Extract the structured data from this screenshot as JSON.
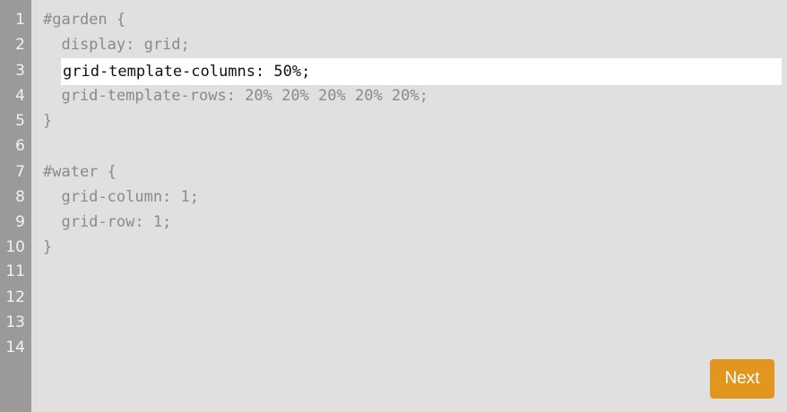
{
  "editor": {
    "line_numbers": [
      "1",
      "2",
      "3",
      "4",
      "5",
      "6",
      "7",
      "8",
      "9",
      "10",
      "11",
      "12",
      "13",
      "14"
    ],
    "lines": {
      "l1": "#garden {",
      "l2": "  display: grid;",
      "l4": "  grid-template-rows: 20% 20% 20% 20% 20%;",
      "l5": "}",
      "l7": "#water {",
      "l8": "  grid-column: 1;",
      "l9": "  grid-row: 1;",
      "l10": "}"
    },
    "input_value": "grid-template-columns: 50%;"
  },
  "actions": {
    "next_label": "Next"
  },
  "colors": {
    "gutter": "#9a9a9a",
    "background": "#e0e0e0",
    "accent_button": "#e0961f"
  }
}
